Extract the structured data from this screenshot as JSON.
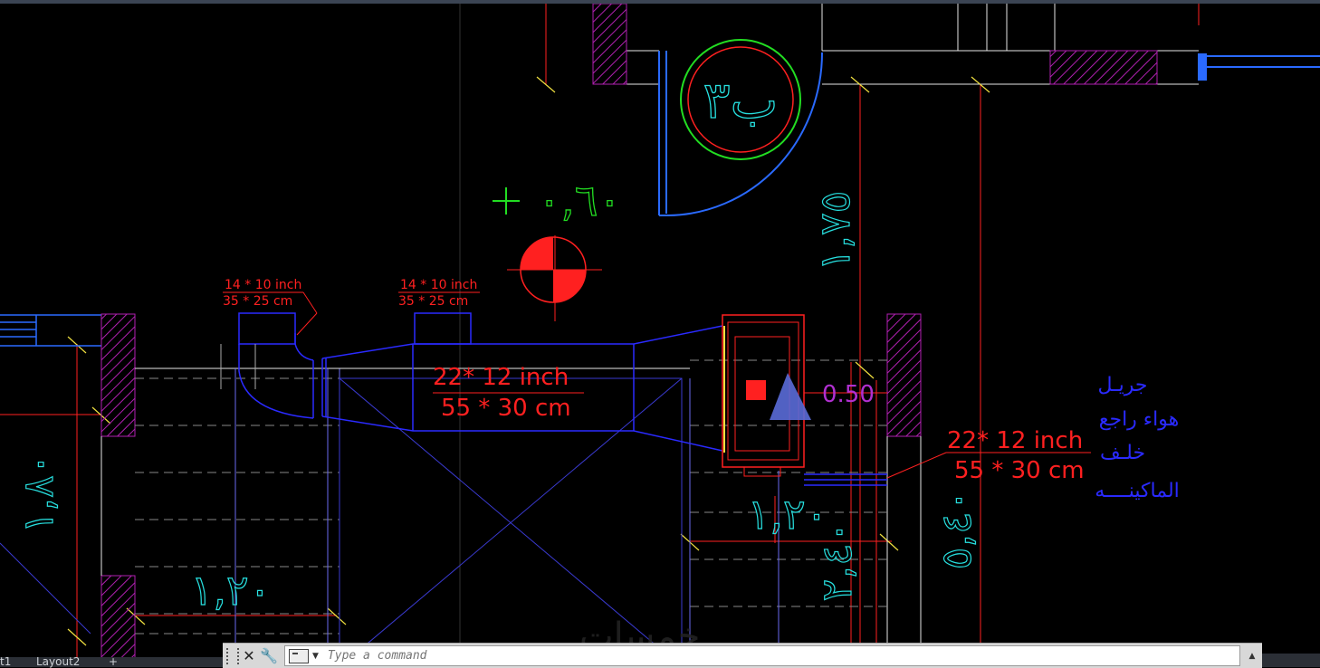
{
  "drawing": {
    "room_label": "ب٣",
    "dim_top_left": "٠,٦٠",
    "dim_vertical_right": "١,٧٥",
    "dim_left": "١,٨٠",
    "dim_bottom_left": "١,٢٠",
    "dim_right_mid": "١,٢٠",
    "dim_right_lower": "٢,٤٠",
    "dim_far_right": "٥,٤٠",
    "offset_value": "0.50",
    "duct_small_1": {
      "line1": "14 * 10 inch",
      "line2": "35 * 25 cm"
    },
    "duct_small_2": {
      "line1": "14 * 10 inch",
      "line2": "35 * 25 cm"
    },
    "duct_main": {
      "line1": "22* 12 inch",
      "line2": "55 * 30 cm"
    },
    "duct_return": {
      "line1": "22* 12 inch",
      "line2": "55 * 30 cm"
    },
    "note": {
      "line1": "جريـل",
      "line2": "هواء راجع",
      "line3": "خلـف",
      "line4": "الماكينــــه"
    }
  },
  "colors": {
    "red": "#ff2020",
    "blue": "#2a2aff",
    "cyan": "#27e0e0",
    "magenta": "#b020b0",
    "green": "#22dd22",
    "white": "#e6e6e6",
    "violet": "#c040ff"
  },
  "command_bar": {
    "placeholder": "Type a command"
  },
  "layout_tabs": {
    "tab_partial": "t1",
    "tab_layout2": "Layout2",
    "add": "+"
  },
  "watermark": "خمسات"
}
